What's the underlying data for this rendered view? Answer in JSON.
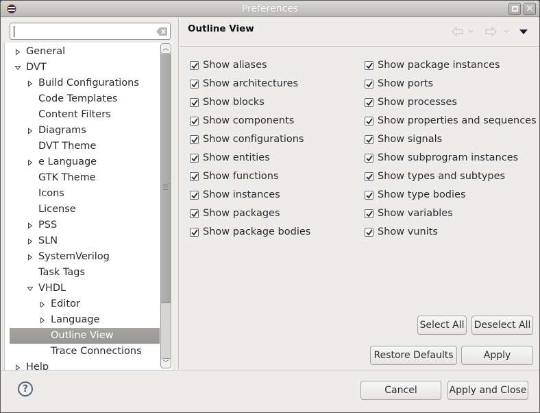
{
  "window": {
    "title": "Preferences",
    "icon": "eclipse-icon",
    "controls": [
      "maximize-icon",
      "close-icon"
    ]
  },
  "search": {
    "value": "",
    "placeholder": ""
  },
  "tree": {
    "items": [
      {
        "label": "General",
        "level": 0,
        "expander": "collapsed"
      },
      {
        "label": "DVT",
        "level": 0,
        "expander": "expanded"
      },
      {
        "label": "Build Configurations",
        "level": 1,
        "expander": "collapsed"
      },
      {
        "label": "Code Templates",
        "level": 1,
        "expander": "none"
      },
      {
        "label": "Content Filters",
        "level": 1,
        "expander": "none"
      },
      {
        "label": "Diagrams",
        "level": 1,
        "expander": "collapsed"
      },
      {
        "label": "DVT Theme",
        "level": 1,
        "expander": "none"
      },
      {
        "label": "e Language",
        "level": 1,
        "expander": "collapsed"
      },
      {
        "label": "GTK Theme",
        "level": 1,
        "expander": "none"
      },
      {
        "label": "Icons",
        "level": 1,
        "expander": "none"
      },
      {
        "label": "License",
        "level": 1,
        "expander": "none"
      },
      {
        "label": "PSS",
        "level": 1,
        "expander": "collapsed"
      },
      {
        "label": "SLN",
        "level": 1,
        "expander": "collapsed"
      },
      {
        "label": "SystemVerilog",
        "level": 1,
        "expander": "collapsed"
      },
      {
        "label": "Task Tags",
        "level": 1,
        "expander": "none"
      },
      {
        "label": "VHDL",
        "level": 1,
        "expander": "expanded"
      },
      {
        "label": "Editor",
        "level": 2,
        "expander": "collapsed"
      },
      {
        "label": "Language",
        "level": 2,
        "expander": "collapsed"
      },
      {
        "label": "Outline View",
        "level": 2,
        "expander": "none",
        "selected": true
      },
      {
        "label": "Trace Connections",
        "level": 2,
        "expander": "none"
      },
      {
        "label": "Help",
        "level": 0,
        "expander": "collapsed"
      }
    ]
  },
  "page": {
    "title": "Outline View",
    "nav": {
      "back": "back-arrow-icon",
      "back_menu": "chevron-down-icon",
      "forward": "forward-arrow-icon",
      "forward_menu": "chevron-down-icon",
      "view_menu": "view-menu-triangle-icon"
    },
    "left_options": [
      {
        "label": "Show aliases",
        "checked": true
      },
      {
        "label": "Show architectures",
        "checked": true
      },
      {
        "label": "Show blocks",
        "checked": true
      },
      {
        "label": "Show components",
        "checked": true
      },
      {
        "label": "Show configurations",
        "checked": true
      },
      {
        "label": "Show entities",
        "checked": true
      },
      {
        "label": "Show functions",
        "checked": true
      },
      {
        "label": "Show instances",
        "checked": true
      },
      {
        "label": "Show packages",
        "checked": true
      },
      {
        "label": "Show package bodies",
        "checked": true
      }
    ],
    "right_options": [
      {
        "label": "Show package instances",
        "checked": true
      },
      {
        "label": "Show ports",
        "checked": true
      },
      {
        "label": "Show processes",
        "checked": true
      },
      {
        "label": "Show properties and sequences",
        "checked": true
      },
      {
        "label": "Show signals",
        "checked": true
      },
      {
        "label": "Show subprogram instances",
        "checked": true
      },
      {
        "label": "Show types and subtypes",
        "checked": true
      },
      {
        "label": "Show type bodies",
        "checked": true
      },
      {
        "label": "Show variables",
        "checked": true
      },
      {
        "label": "Show vunits",
        "checked": true
      }
    ],
    "select_all": "Select All",
    "deselect_all": "Deselect All",
    "restore_defaults": "Restore Defaults",
    "apply": "Apply"
  },
  "footer": {
    "help_icon": "?",
    "cancel": "Cancel",
    "apply_and_close": "Apply and Close"
  },
  "colors": {
    "selection": "#9e9d99",
    "dialog_bg": "#edecea",
    "help_icon": "#54637e"
  }
}
